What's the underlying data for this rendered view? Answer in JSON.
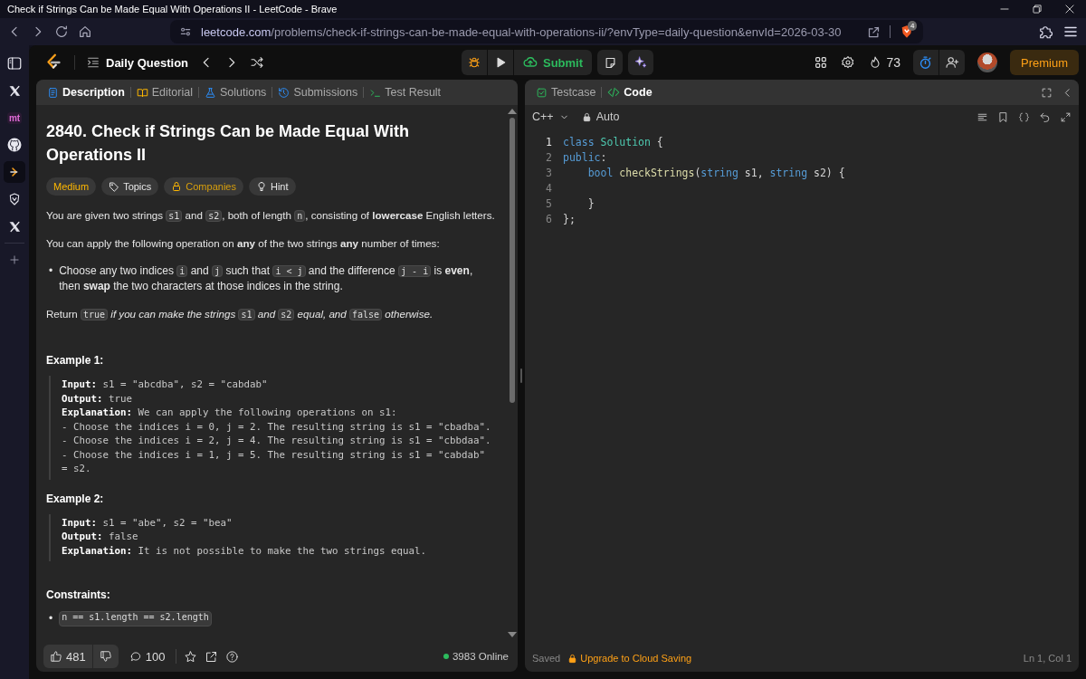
{
  "window": {
    "title": "Check if Strings Can be Made Equal With Operations II - LeetCode - Brave"
  },
  "browser": {
    "url_host": "leetcode.com",
    "url_path": "/problems/check-if-strings-can-be-made-equal-with-operations-ii/?envType=daily-question&envId=2026-03-30",
    "shields_count": "4"
  },
  "sidebar": {
    "items": [
      {
        "kind": "panel",
        "selected": false
      },
      {
        "kind": "x",
        "selected": false
      },
      {
        "kind": "text",
        "label": "mt",
        "selected": false
      },
      {
        "kind": "github",
        "selected": false
      },
      {
        "kind": "leetcode",
        "selected": true
      },
      {
        "kind": "shield",
        "selected": false
      },
      {
        "kind": "x",
        "selected": false
      },
      {
        "kind": "add",
        "selected": false
      }
    ]
  },
  "header": {
    "title": "Daily Question",
    "submit": "Submit",
    "streak": "73",
    "premium": "Premium"
  },
  "left_panel": {
    "tabs": [
      {
        "label": "Description",
        "kind": "description",
        "selected": true
      },
      {
        "label": "Editorial",
        "kind": "editorial",
        "selected": false
      },
      {
        "label": "Solutions",
        "kind": "solutions",
        "selected": false
      },
      {
        "label": "Submissions",
        "kind": "submissions",
        "selected": false
      },
      {
        "label": "Test Result",
        "kind": "result",
        "selected": false
      }
    ],
    "problem": {
      "title": "2840. Check if Strings Can be Made Equal With Operations II",
      "tags": [
        {
          "label": "Medium",
          "kind": "difficulty"
        },
        {
          "label": "Topics",
          "kind": "topics"
        },
        {
          "label": "Companies",
          "kind": "companies"
        },
        {
          "label": "Hint",
          "kind": "hint"
        }
      ],
      "body": [
        {
          "kind": "paragraph",
          "segments": [
            {
              "kind": "text",
              "text": "You are given two strings "
            },
            {
              "kind": "code",
              "text": "s1"
            },
            {
              "kind": "text",
              "text": " and "
            },
            {
              "kind": "code",
              "text": "s2"
            },
            {
              "kind": "text",
              "text": ", both of length "
            },
            {
              "kind": "code",
              "text": "n"
            },
            {
              "kind": "text",
              "text": ", consisting of **lowercase** English letters."
            }
          ]
        },
        {
          "kind": "paragraph",
          "segments": [
            {
              "kind": "text",
              "text": "You can apply the following operation on **any** of the two strings **any** number of times:"
            }
          ]
        },
        {
          "kind": "bullet",
          "marker": "•",
          "segments": [
            {
              "kind": "text",
              "text": "Choose any two indices "
            },
            {
              "kind": "code",
              "text": "i"
            },
            {
              "kind": "text",
              "text": " and "
            },
            {
              "kind": "code",
              "text": "j"
            },
            {
              "kind": "text",
              "text": " such that "
            },
            {
              "kind": "code",
              "text": "i < j"
            },
            {
              "kind": "text",
              "text": " and the difference "
            },
            {
              "kind": "code",
              "text": "j - i"
            },
            {
              "kind": "text",
              "text": " is **even**, then **swap** the two characters at those indices in the string."
            }
          ]
        },
        {
          "kind": "paragraph",
          "segments": [
            {
              "kind": "text",
              "text": "Return "
            },
            {
              "kind": "code",
              "text": "true"
            },
            {
              "kind": "em",
              "text": " if you can make the strings "
            },
            {
              "kind": "code",
              "text": "s1"
            },
            {
              "kind": "em",
              "text": " and "
            },
            {
              "kind": "code",
              "text": "s2"
            },
            {
              "kind": "em",
              "text": " equal, and "
            },
            {
              "kind": "code",
              "text": "false"
            },
            {
              "kind": "em",
              "text": " otherwise."
            }
          ]
        }
      ],
      "examples": [
        {
          "title": "Example 1:",
          "lines": [
            "**Input:** s1 = \"abcdba\", s2 = \"cabdab\"",
            "**Output:** true",
            "**Explanation:** We can apply the following operations on s1:",
            "- Choose the indices i = 0, j = 2. The resulting string is s1 = \"cbadba\".",
            "- Choose the indices i = 2, j = 4. The resulting string is s1 = \"cbbdaa\".",
            "- Choose the indices i = 1, j = 5. The resulting string is s1 = \"cabdab\"",
            "= s2."
          ]
        },
        {
          "title": "Example 2:",
          "lines": [
            "**Input:** s1 = \"abe\", s2 = \"bea\"",
            "**Output:** false",
            "**Explanation:** It is not possible to make the two strings equal."
          ]
        }
      ],
      "constraints_title": "Constraints:",
      "constraints": [
        {
          "marker": "•",
          "text": "n == s1.length == s2.length"
        }
      ]
    },
    "footer": {
      "likes": "481",
      "comments": "100",
      "online": "3983 Online"
    }
  },
  "right_panel": {
    "tabs": [
      {
        "label": "Testcase",
        "kind": "testcase",
        "selected": false
      },
      {
        "label": "Code",
        "kind": "code",
        "selected": true
      }
    ],
    "language": "C++",
    "mode": "Auto",
    "code": [
      {
        "number": "1",
        "tokens": [
          {
            "kind": "kw",
            "text": "class"
          },
          {
            "kind": "type",
            "text": " Solution"
          },
          {
            "kind": "plain",
            "text": " {"
          }
        ]
      },
      {
        "number": "2",
        "tokens": [
          {
            "kind": "kw",
            "text": "public"
          },
          {
            "kind": "plain",
            "text": ":"
          }
        ]
      },
      {
        "number": "3",
        "tokens": [
          {
            "kind": "kw",
            "text": "    bool"
          },
          {
            "kind": "fn",
            "text": " checkStrings"
          },
          {
            "kind": "plain",
            "text": "("
          },
          {
            "kind": "kw",
            "text": "string"
          },
          {
            "kind": "plain",
            "text": " s1, "
          },
          {
            "kind": "kw",
            "text": "string"
          },
          {
            "kind": "plain",
            "text": " s2) {"
          }
        ]
      },
      {
        "number": "4"
      },
      {
        "number": "5",
        "tokens": [
          {
            "kind": "plain",
            "text": "    }"
          }
        ]
      },
      {
        "number": "6",
        "tokens": [
          {
            "kind": "plain",
            "text": "};"
          }
        ]
      }
    ],
    "status": {
      "saved": "Saved",
      "upgrade": "Upgrade to Cloud Saving",
      "cursor": "Ln 1, Col 1"
    }
  }
}
